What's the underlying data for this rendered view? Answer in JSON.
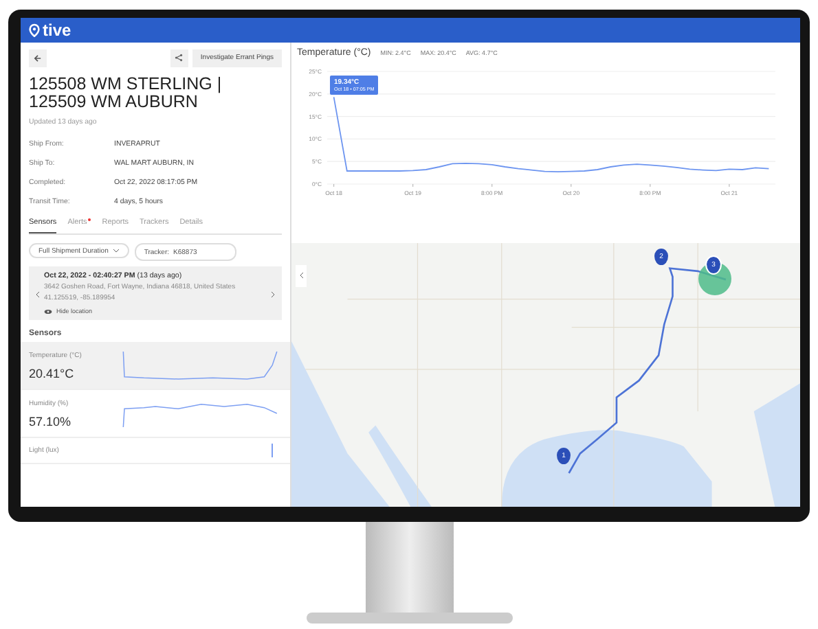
{
  "app": {
    "logo": "tive"
  },
  "shipment": {
    "action_button": "Investigate Errant Pings",
    "title": "125508 WM STERLING | 125509 WM AUBURN",
    "updated": "Updated 13 days ago",
    "details": [
      {
        "label": "Ship From:",
        "value": "INVERAPRUT"
      },
      {
        "label": "Ship To:",
        "value": "WAL MART AUBURN, IN"
      },
      {
        "label": "Completed:",
        "value": "Oct 22, 2022 08:17:05 PM"
      },
      {
        "label": "Transit Time:",
        "value": "4 days, 5 hours"
      }
    ],
    "tabs": [
      {
        "label": "Sensors",
        "selected": true,
        "alert": false
      },
      {
        "label": "Alerts",
        "selected": false,
        "alert": true
      },
      {
        "label": "Reports",
        "selected": false,
        "alert": false
      },
      {
        "label": "Trackers",
        "selected": false,
        "alert": false
      },
      {
        "label": "Details",
        "selected": false,
        "alert": false
      }
    ],
    "duration_select": "Full Shipment Duration",
    "tracker_label": "Tracker:",
    "tracker_value": "K68873",
    "location": {
      "time": "Oct 22, 2022 - 02:40:27 PM",
      "ago": "(13 days ago)",
      "address": "3642 Goshen Road, Fort Wayne, Indiana 46818, United States",
      "coords": "41.125519, -85.189954",
      "hide_link": "Hide location"
    },
    "sensors_heading": "Sensors",
    "sensors": [
      {
        "name": "Temperature (°C)",
        "value": "20.41°C",
        "selected": true
      },
      {
        "name": "Humidity (%)",
        "value": "57.10%",
        "selected": false
      },
      {
        "name": "Light (lux)",
        "selected": false
      }
    ]
  },
  "temperature_panel": {
    "title": "Temperature (°C)",
    "stats": [
      "MIN: 2.4°C",
      "MAX: 20.4°C",
      "AVG: 4.7°C"
    ],
    "tooltip": {
      "value": "19.34°C",
      "time": "Oct 18 • 07:05 PM"
    },
    "chart_data": {
      "type": "line",
      "categories": [
        "Oct 18",
        null,
        null,
        null,
        null,
        null,
        "Oct 19",
        null,
        null,
        null,
        null,
        null,
        "8:00 PM",
        null,
        null,
        null,
        null,
        null,
        "Oct 20",
        null,
        null,
        null,
        null,
        null,
        "8:00 PM",
        null,
        null,
        null,
        null,
        null,
        "Oct 21",
        null,
        null,
        null
      ],
      "series": [
        {
          "color": "#6d95f0",
          "values": [
            19.3,
            2.9,
            2.9,
            2.9,
            2.9,
            2.9,
            3,
            3.2,
            3.8,
            4.5,
            4.6,
            4.5,
            4.3,
            3.8,
            3.4,
            3.1,
            2.8,
            2.7,
            2.8,
            2.9,
            3.2,
            3.8,
            4.2,
            4.4,
            4.2,
            4.0,
            3.7,
            3.3,
            3.1,
            3.0,
            3.3,
            3.2,
            3.6,
            3.4
          ]
        }
      ],
      "ylim": [
        0,
        25
      ],
      "grid": true,
      "yticks": [
        {
          "value": 0,
          "label": "0°C"
        },
        {
          "value": 5,
          "label": "5°C"
        },
        {
          "value": 10,
          "label": "10°C"
        },
        {
          "value": 15,
          "label": "15°C"
        },
        {
          "value": 20,
          "label": "20°C"
        },
        {
          "value": 25,
          "label": "25°C"
        }
      ]
    }
  },
  "map": {
    "markers": [
      {
        "label": "1",
        "selected": false
      },
      {
        "label": "2",
        "selected": false
      },
      {
        "label": "3",
        "selected": true
      }
    ]
  }
}
